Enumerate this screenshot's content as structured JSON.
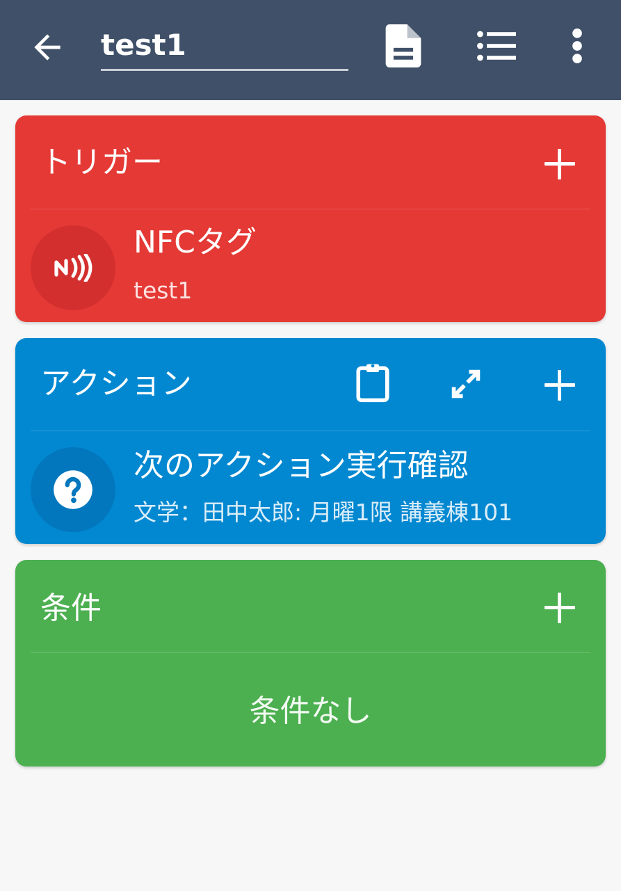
{
  "toolbar": {
    "title": "test1",
    "icons": [
      "back-arrow-icon",
      "document-icon",
      "list-icon",
      "more-vert-icon"
    ]
  },
  "trigger": {
    "title": "トリガー",
    "items": [
      {
        "icon": "nfc-icon",
        "title": "NFCタグ",
        "subtitle": "test1"
      }
    ]
  },
  "action": {
    "title": "アクション",
    "items": [
      {
        "icon": "help-icon",
        "title": "次のアクション実行確認",
        "subtitle": "文学：田中太郎: 月曜1限  講義棟101"
      }
    ]
  },
  "condition": {
    "title": "条件",
    "empty_text": "条件なし"
  },
  "colors": {
    "toolbar": "#3f5068",
    "trigger": "#e53935",
    "action": "#0288d1",
    "condition": "#4caf50",
    "background": "#f7f7f7"
  }
}
